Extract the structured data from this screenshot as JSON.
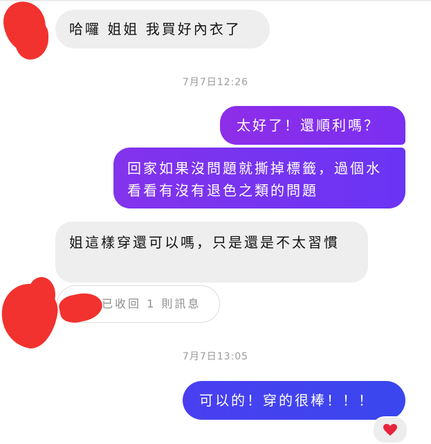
{
  "messages": [
    {
      "side": "incoming",
      "text": "哈囉 姐姐 我買好內衣了"
    },
    {
      "type": "timestamp",
      "text": "7月7日12:26"
    },
    {
      "side": "outgoing",
      "text": "太好了！還順利嗎？"
    },
    {
      "side": "outgoing",
      "text": "回家如果沒問題就撕掉標籤，過個水看看有沒有退色之類的問題"
    },
    {
      "side": "incoming",
      "text": "姐這樣穿還可以嗎，只是還是不太習慣"
    },
    {
      "type": "recalled",
      "text": "已收回 1 則訊息"
    },
    {
      "type": "timestamp",
      "text": "7月7日13:05"
    },
    {
      "side": "outgoing",
      "text": "可以的！穿的很棒！！！"
    }
  ],
  "reaction": {
    "icon": "heart-icon",
    "color": "#e8243c"
  },
  "colors": {
    "incoming_bubble": "#eeeeef",
    "outgoing_purple": "#7b2ff0",
    "outgoing_indigo": "#3d44ee",
    "redaction": "#f2322f"
  }
}
